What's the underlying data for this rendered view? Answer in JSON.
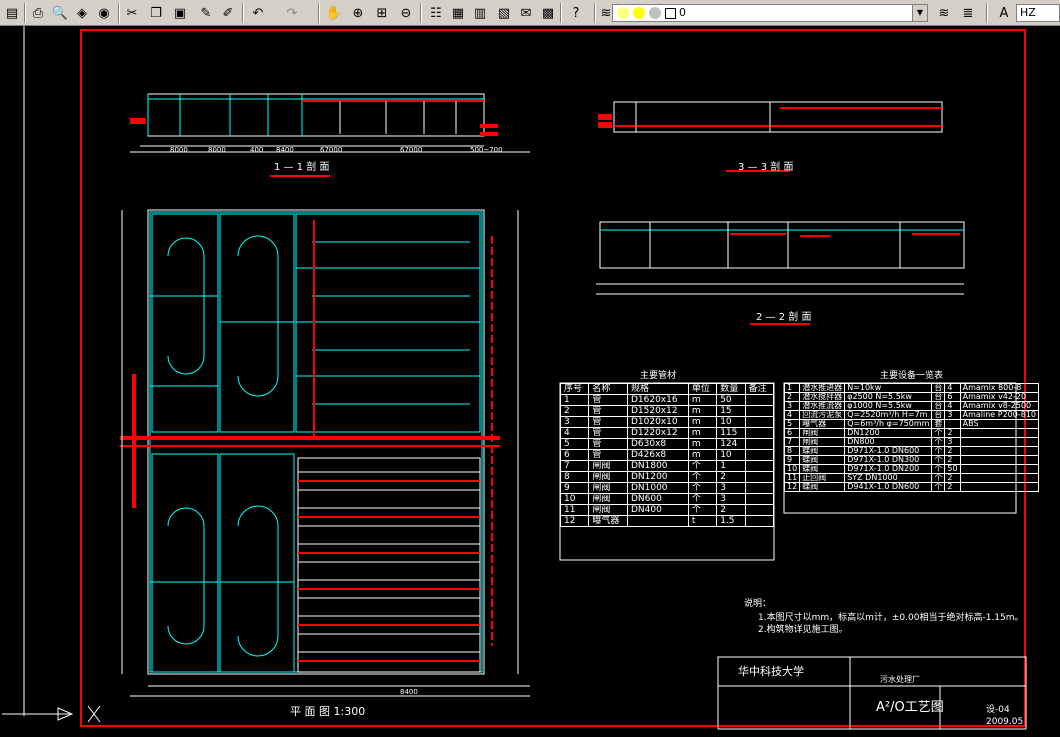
{
  "toolbar": {
    "layer_name": "0",
    "text_style": "HZ",
    "icons": [
      "file-icon",
      "print-icon",
      "preview-icon",
      "publish-icon",
      "cut-icon",
      "copy-icon",
      "paste-icon",
      "match-properties-icon",
      "block-editor-icon",
      "undo-icon",
      "redo-icon",
      "pan-icon",
      "zoom-realtime-icon",
      "zoom-window-icon",
      "zoom-previous-icon",
      "properties-icon",
      "design-center-icon",
      "tool-palettes-icon",
      "sheet-set-icon",
      "markup-icon",
      "calculator-icon",
      "help-icon"
    ]
  },
  "drawing": {
    "section_1_title": "1 — 1 剖 面",
    "section_2_title": "2 — 2 剖 面",
    "section_3_title": "3 — 3 剖 面",
    "plan_title": "平 面 图 1:300",
    "pipe_table_title": "主要管材",
    "equipment_table_title": "主要设备一览表",
    "notes_title": "说明：",
    "note_1": "1.本图尺寸以mm，标高以m计，±0.00相当于绝对标高-1.15m。",
    "note_2": "2.构筑物详见施工图。",
    "university": "华中科技大学",
    "design_title": "A²/O工艺图",
    "drawing_no": "设-04",
    "date": "2009.05",
    "project_name": "污水处理厂",
    "dims": {
      "d1": "8000",
      "d2": "8000",
      "d3": "400",
      "d4": "8400",
      "d5": "67000",
      "d6": "67000",
      "d7": "500~700",
      "d8": "8400"
    }
  },
  "pipe_table": [
    [
      "1",
      "管",
      "D1620x16",
      "m",
      "50"
    ],
    [
      "2",
      "管",
      "D1520x12",
      "m",
      "15"
    ],
    [
      "3",
      "管",
      "D1020x10",
      "m",
      "10"
    ],
    [
      "4",
      "管",
      "D1220x12",
      "m",
      "115"
    ],
    [
      "5",
      "管",
      "D630x8",
      "m",
      "124"
    ],
    [
      "6",
      "管",
      "D426x8",
      "m",
      "10"
    ],
    [
      "7",
      "闸阀",
      "DN1800",
      "个",
      "1"
    ],
    [
      "8",
      "闸阀",
      "DN1200",
      "个",
      "2"
    ],
    [
      "9",
      "闸阀",
      "DN1000",
      "个",
      "3"
    ],
    [
      "10",
      "闸阀",
      "DN600",
      "个",
      "3"
    ],
    [
      "11",
      "闸阀",
      "DN400",
      "个",
      "2"
    ],
    [
      "12",
      "曝气器",
      "",
      "t",
      "1.5"
    ]
  ],
  "pipe_table_header": [
    "序号",
    "名称",
    "规格",
    "单位",
    "数量",
    "备注"
  ],
  "equipment_table": [
    [
      "1",
      "潜水推进器",
      "N=10kw",
      "台",
      "4",
      "Amamix 800-8"
    ],
    [
      "2",
      "潜水搅拌器",
      "φ2500 N=5.5kw",
      "台",
      "6",
      "Amamix v42-20"
    ],
    [
      "3",
      "潜水推流器",
      "φ1000 N=5.5kw",
      "台",
      "4",
      "Amamix v8-2500"
    ],
    [
      "4",
      "回流污泥泵",
      "Q=2520m³/h H=7m",
      "台",
      "3",
      "Amaline P200-810"
    ],
    [
      "5",
      "曝气器",
      "Q=6m³/h φ=750mm",
      "套",
      "",
      "ABS"
    ],
    [
      "6",
      "闸阀",
      "DN1200",
      "个",
      "2",
      ""
    ],
    [
      "7",
      "闸阀",
      "DN800",
      "个",
      "3",
      ""
    ],
    [
      "8",
      "蝶阀",
      "D971X-1.0 DN600",
      "个",
      "2",
      ""
    ],
    [
      "9",
      "蝶阀",
      "D971X-1.0 DN300",
      "个",
      "2",
      ""
    ],
    [
      "10",
      "蝶阀",
      "D971X-1.0 DN200",
      "个",
      "50",
      ""
    ],
    [
      "11",
      "止回阀",
      "SYZ DN1000",
      "个",
      "2",
      ""
    ],
    [
      "12",
      "蝶阀",
      "D941X-1.0 DN600",
      "个",
      "2",
      ""
    ]
  ]
}
